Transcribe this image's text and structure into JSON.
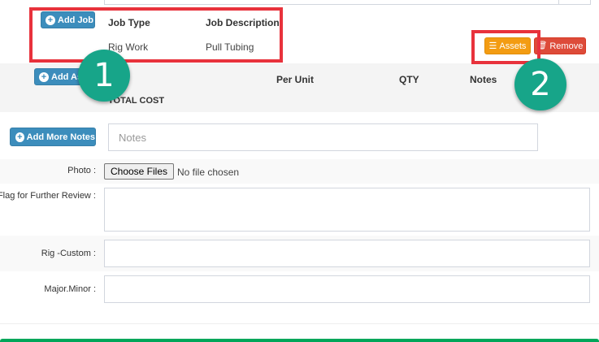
{
  "job_section": {
    "add_job_label": "Add Job",
    "headers": {
      "job_type": "Job Type",
      "job_description": "Job Description"
    },
    "row": {
      "job_type": "Rig Work",
      "job_description": "Pull Tubing"
    }
  },
  "asset_section": {
    "add_asset_label": "Add As",
    "headers": {
      "per_unit": "Per Unit",
      "qty": "QTY",
      "notes": "Notes"
    },
    "total_cost_label": "TOTAL COST",
    "assets_button_label": "Assets",
    "remove_button_label": "Remove"
  },
  "notes_section": {
    "add_notes_label": "Add More Notes",
    "notes_placeholder": "Notes"
  },
  "photo": {
    "label": "Photo :",
    "choose_button_label": "Choose Files",
    "status_text": "No file chosen"
  },
  "fields": {
    "flag_label": "Flag for Further Review :",
    "rig_custom_label": "Rig -Custom :",
    "major_minor_label": "Major.Minor :"
  },
  "annotations": {
    "badge_1": "1",
    "badge_2": "2",
    "highlight_color": "#e8323c",
    "badge_color": "#17a589"
  },
  "colors": {
    "primary": "#3c8dbc",
    "warning": "#f39c12",
    "danger": "#dd4b39",
    "success": "#00a65a"
  },
  "icons": {
    "add_job": "plus-circle-icon",
    "assets": "list-icon",
    "remove": "trash-icon"
  }
}
